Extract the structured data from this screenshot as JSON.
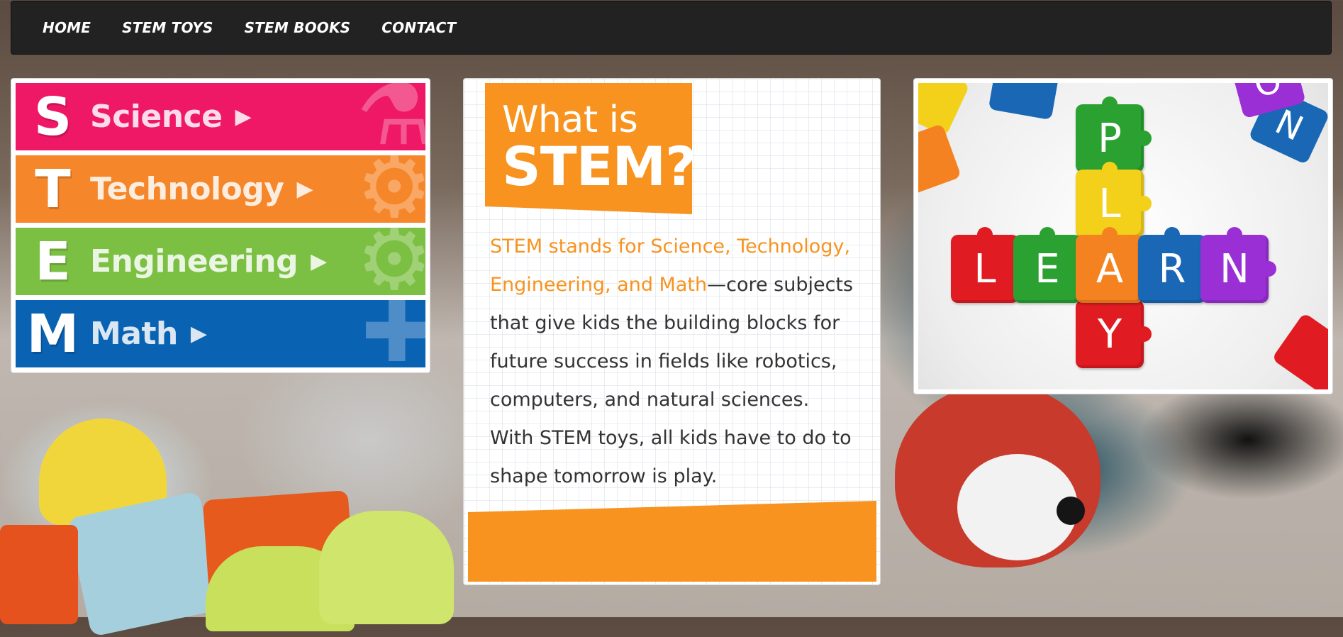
{
  "nav": {
    "items": [
      "HOME",
      "STEM TOYS",
      "STEM BOOKS",
      "CONTACT"
    ]
  },
  "stem": {
    "rows": [
      {
        "letter": "S",
        "word": "Science",
        "color": "#ef1866",
        "icon": "microscope-icon",
        "glyph": "⚗"
      },
      {
        "letter": "T",
        "word": "Technology",
        "color": "#f5862a",
        "icon": "circuit-icon",
        "glyph": "⚙"
      },
      {
        "letter": "E",
        "word": "Engineering",
        "color": "#7cc043",
        "icon": "gear-icon",
        "glyph": "⚙"
      },
      {
        "letter": "M",
        "word": "Math",
        "color": "#0a62b3",
        "icon": "plus-icon",
        "glyph": "✚"
      }
    ],
    "arrow": "▶"
  },
  "what": {
    "line1": "What is",
    "line2": "STEM?",
    "highlight": "STEM stands for Science, Technology, Engineering, and Math",
    "body": "—core subjects that give kids the building blocks for future success in fields like robotics, computers, and natural sciences. With STEM toys, all kids have to do to shape tomorrow is play.",
    "accent": "#f7931e"
  },
  "puzzle": {
    "vertical": [
      {
        "letter": "P",
        "color": "#2aa131"
      },
      {
        "letter": "L",
        "color": "#f3d019"
      },
      {
        "letter": "Y",
        "color": "#e11b22"
      }
    ],
    "horizontal": [
      {
        "letter": "L",
        "color": "#e11b22"
      },
      {
        "letter": "E",
        "color": "#2aa131"
      },
      {
        "letter": "A",
        "color": "#f58220"
      },
      {
        "letter": "R",
        "color": "#1a67b5"
      },
      {
        "letter": "N",
        "color": "#9b2fd6"
      }
    ],
    "corners": [
      {
        "letter": "N",
        "color": "#1a67b5"
      },
      {
        "letter": "O",
        "color": "#9b2fd6"
      }
    ]
  }
}
